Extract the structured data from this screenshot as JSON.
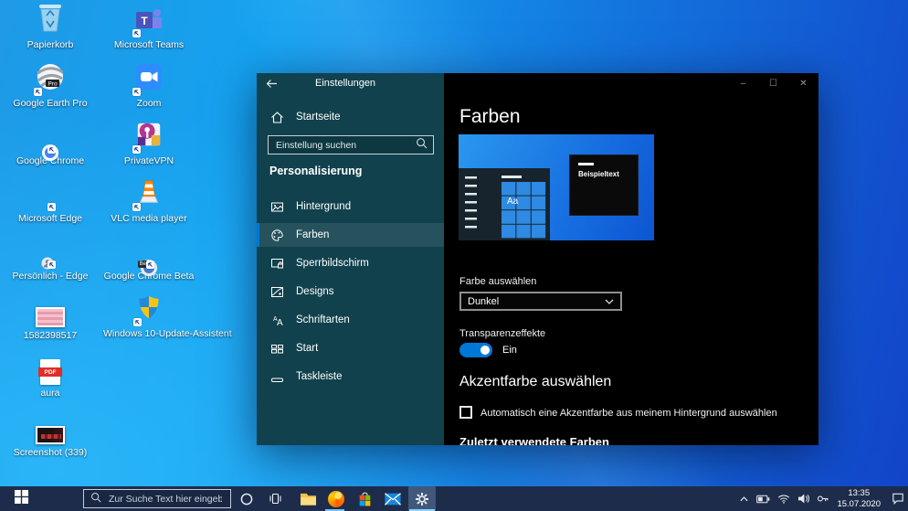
{
  "colors": {
    "accent": "#0078d7",
    "sidebar_teal": "#11414d",
    "content_black": "#000000",
    "taskbar_navy": "#1e2c4b",
    "desktop_blue_light": "#15a2f0",
    "desktop_blue_deep": "#1243c8"
  },
  "desktop": {
    "icons": [
      {
        "label": "Papierkorb"
      },
      {
        "label": "Microsoft Teams"
      },
      {
        "label": "Google Earth Pro"
      },
      {
        "label": "Zoom"
      },
      {
        "label": "Google Chrome"
      },
      {
        "label": "PrivateVPN"
      },
      {
        "label": "Microsoft Edge"
      },
      {
        "label": "VLC media player"
      },
      {
        "label": "Persönlich - Edge"
      },
      {
        "label": "Google Chrome Beta"
      },
      {
        "label": "1582398517"
      },
      {
        "label": "Windows 10-Update-Assistent"
      },
      {
        "label": "aura"
      },
      {
        "label": "Screenshot (339)"
      }
    ],
    "badges": {
      "pro": "Pro",
      "beta": "Beta",
      "pdf": "PDF",
      "teams_t": "T"
    }
  },
  "window": {
    "titlebar": {
      "title": "Einstellungen",
      "minimize": "–",
      "maximize": "☐",
      "close": "✕"
    }
  },
  "sidebar": {
    "home_label": "Startseite",
    "search_placeholder": "Einstellung suchen",
    "section_label": "Personalisierung",
    "items": [
      {
        "label": "Hintergrund",
        "icon": "image-icon",
        "selected": false
      },
      {
        "label": "Farben",
        "icon": "palette-icon",
        "selected": true
      },
      {
        "label": "Sperrbildschirm",
        "icon": "lockscreen-icon",
        "selected": false
      },
      {
        "label": "Designs",
        "icon": "themes-icon",
        "selected": false
      },
      {
        "label": "Schriftarten",
        "icon": "fonts-icon",
        "selected": false
      },
      {
        "label": "Start",
        "icon": "start-layout-icon",
        "selected": false
      },
      {
        "label": "Taskleiste",
        "icon": "taskbar-icon",
        "selected": false
      }
    ]
  },
  "content": {
    "title": "Farben",
    "preview": {
      "tile_label": "Aa",
      "sample_label": "Beispieltext"
    },
    "color_select_label": "Farbe auswählen",
    "color_select_value": "Dunkel",
    "transparency_label": "Transparenzeffekte",
    "transparency_state": "Ein",
    "transparency_enabled": true,
    "accent_title": "Akzentfarbe auswählen",
    "accent_checkbox_label": "Automatisch eine Akzentfarbe aus meinem Hintergrund auswählen",
    "accent_checkbox_checked": false,
    "recent_colors_label": "Zuletzt verwendete Farben"
  },
  "taskbar": {
    "search_placeholder": "Zur Suche Text hier eingeben",
    "apps": [
      "file-explorer",
      "firefox",
      "microsoft-store",
      "mail",
      "settings"
    ],
    "running_apps": [
      "firefox",
      "settings"
    ],
    "active_app": "settings",
    "tray_icons": [
      "hidden-icons-chevron",
      "battery",
      "wifi",
      "volume",
      "key"
    ],
    "tray": {
      "time": "13:35",
      "date": "15.07.2020"
    }
  }
}
